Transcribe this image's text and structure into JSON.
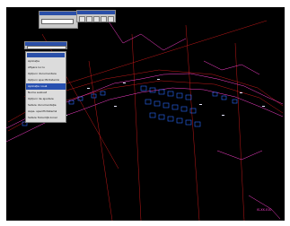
{
  "window": {
    "background": "#000000",
    "frame": "#ffffff"
  },
  "colors": {
    "parcel": "#ff40d0",
    "road": "#c01818",
    "building": "#2b6cff",
    "label": "#e8e8ff",
    "menu_selected": "#2850b0"
  },
  "toolbar_top": {
    "field_value": ""
  },
  "toolbar_left": {
    "field_value": ""
  },
  "context_menu": {
    "items": [
      {
        "label": "Aplicaţie",
        "selected": false
      },
      {
        "label": "Afişare lucru",
        "selected": false
      },
      {
        "label": "Opţiuni documentare",
        "selected": false
      },
      {
        "label": "Opţiuni specificitatemă",
        "selected": false
      },
      {
        "label": "Aplicaţie nouă",
        "selected": true
      },
      {
        "label": "Nume evaluat",
        "selected": false
      },
      {
        "label": "Opţiuni de ajustare",
        "selected": false
      },
      {
        "label": "Setare documentaţie",
        "selected": false
      },
      {
        "label": "Aspe. specificitatemă",
        "selected": false
      },
      {
        "label": "Setare folosinţă zonal",
        "selected": false
      }
    ]
  },
  "stamp": {
    "text": "IS-XX-010"
  }
}
